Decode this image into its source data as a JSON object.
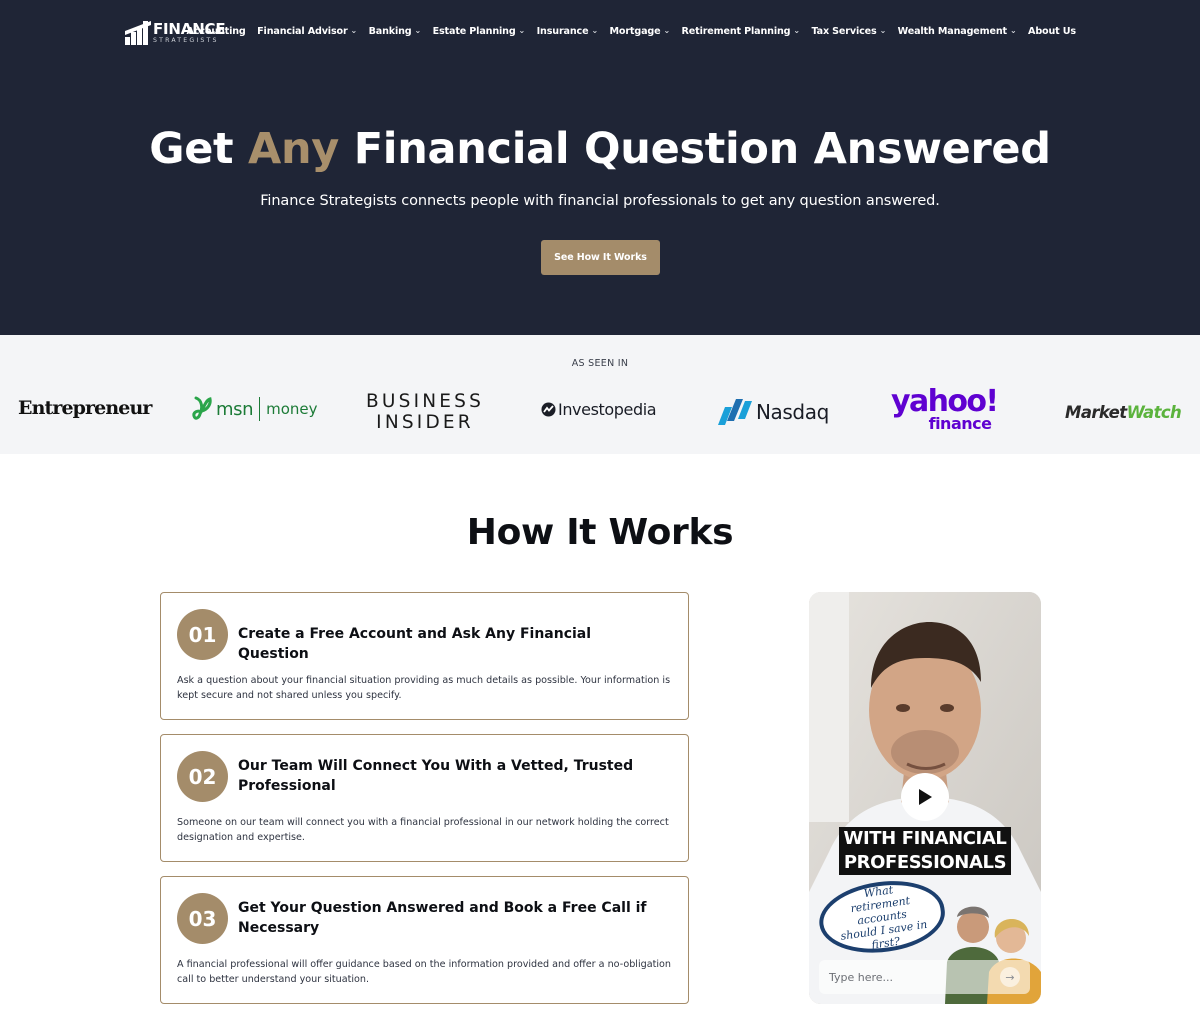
{
  "brand": {
    "name": "FINANCE",
    "sub": "STRATEGISTS"
  },
  "nav": {
    "items": [
      {
        "label": "Accounting",
        "dropdown": false
      },
      {
        "label": "Financial Advisor",
        "dropdown": true
      },
      {
        "label": "Banking",
        "dropdown": true
      },
      {
        "label": "Estate Planning",
        "dropdown": true
      },
      {
        "label": "Insurance",
        "dropdown": true
      },
      {
        "label": "Mortgage",
        "dropdown": true
      },
      {
        "label": "Retirement Planning",
        "dropdown": true
      },
      {
        "label": "Tax Services",
        "dropdown": true
      },
      {
        "label": "Wealth Management",
        "dropdown": true
      },
      {
        "label": "About Us",
        "dropdown": false
      }
    ]
  },
  "hero": {
    "title_before": "Get ",
    "title_accent": "Any",
    "title_after": " Financial Question Answered",
    "subtitle": "Finance Strategists connects people with financial professionals to get any question answered.",
    "cta": "See How It Works"
  },
  "as_seen_in": {
    "label": "AS SEEN IN",
    "logos": {
      "entrepreneur": "Entrepreneur",
      "msn_1": "msn",
      "msn_2": "money",
      "bi_1": "BUSINESS",
      "bi_2": "INSIDER",
      "investopedia": "Investopedia",
      "nasdaq": "Nasdaq",
      "yahoo_1": "yahoo!",
      "yahoo_2": "finance",
      "mw_1": "Market",
      "mw_2": "Watch"
    }
  },
  "how": {
    "title": "How It Works",
    "steps": [
      {
        "num": "01",
        "heading": "Create a Free Account and Ask Any Financial Question",
        "desc": "Ask a question about your financial situation providing as much details as possible. Your information is kept secure and not shared unless you specify."
      },
      {
        "num": "02",
        "heading": "Our Team Will Connect You With a Vetted, Trusted Professional",
        "desc": "Someone on our team will connect you with a financial professional in our network holding the correct designation and expertise."
      },
      {
        "num": "03",
        "heading": "Get Your Question Answered and Book a Free Call if Necessary",
        "desc": "A financial professional will offer guidance based on the information provided and offer a no-obligation call to better understand your situation."
      }
    ]
  },
  "video": {
    "caption_1": "WITH FINANCIAL",
    "caption_2": "PROFESSIONALS",
    "bubble": "What retirement accounts should I save in first?",
    "input_placeholder": "Type here..."
  },
  "colors": {
    "navy": "#1f2536",
    "gold": "#a48c6a",
    "light": "#f4f5f7"
  }
}
